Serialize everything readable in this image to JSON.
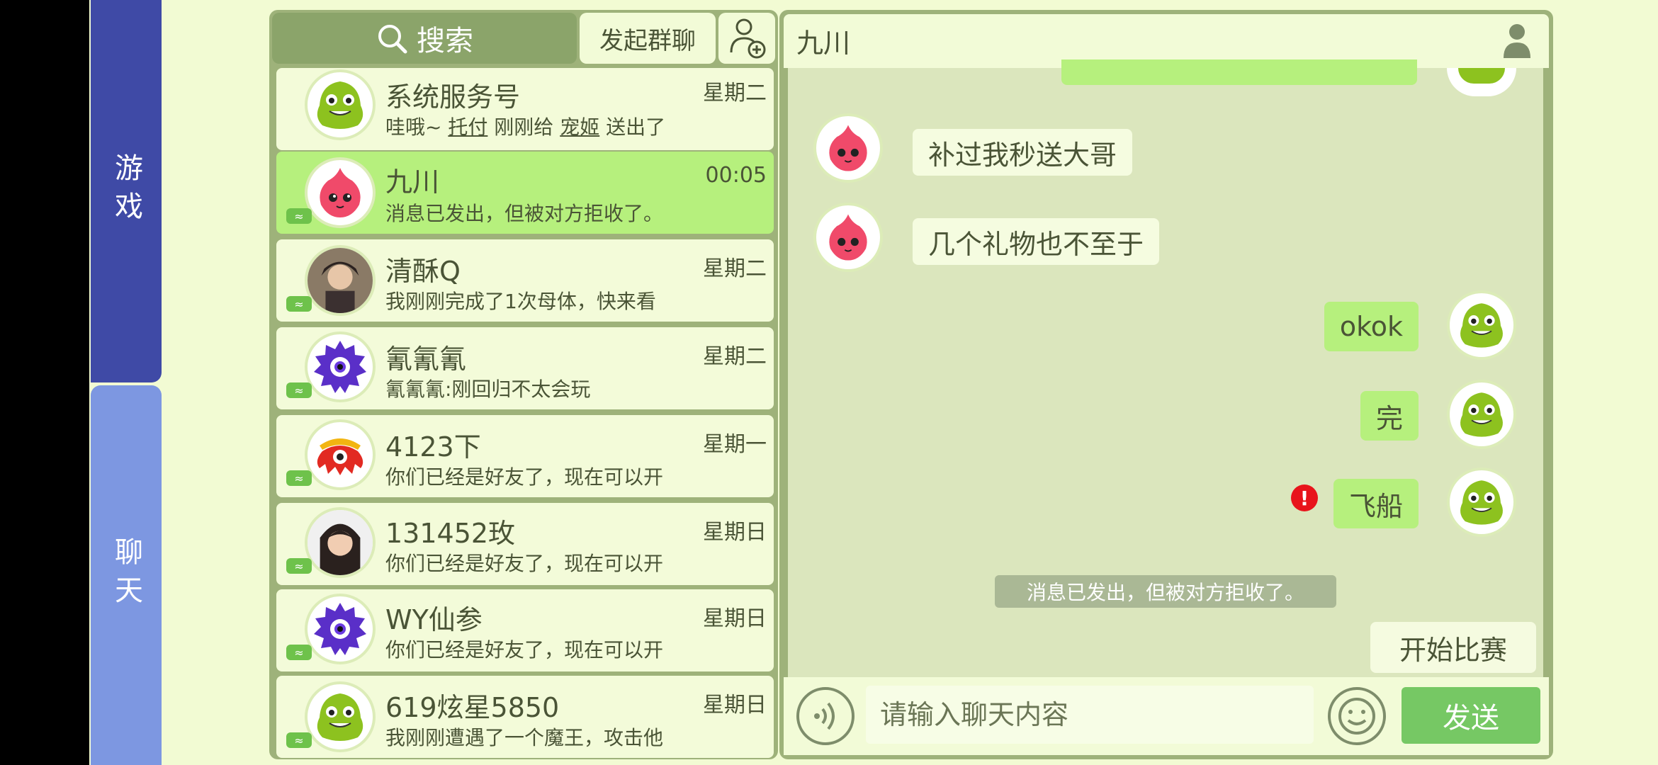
{
  "sidebar": {
    "tabs": [
      {
        "label": "游戏",
        "active": false
      },
      {
        "label": "聊天",
        "active": true
      }
    ]
  },
  "chat_list": {
    "search_label": "搜索",
    "group_chat_label": "发起群聊",
    "items": [
      {
        "name": "系统服务号",
        "time": "星期二",
        "preview_parts": [
          "哇哦~ ",
          "托付",
          " 刚刚给 ",
          "宠姬",
          " 送出了"
        ],
        "avatar": "green-monster-avatar",
        "active": false
      },
      {
        "name": "九川",
        "time": "00:05",
        "preview": "消息已发出，但被对方拒收了。",
        "avatar": "pink-blob-avatar",
        "active": true
      },
      {
        "name": "清酥Q",
        "time": "星期二",
        "preview": "我刚刚完成了1次母体，快来看",
        "avatar": "photo-avatar",
        "active": false
      },
      {
        "name": "氰氰氰",
        "time": "星期二",
        "preview": "氰氰氰:刚回归不太会玩",
        "avatar": "purple-spiky-avatar",
        "active": false
      },
      {
        "name": "4123下",
        "time": "星期一",
        "preview": "你们已经是好友了，现在可以开",
        "avatar": "red-octopus-avatar",
        "active": false
      },
      {
        "name": "131452玫",
        "time": "星期日",
        "preview": "你们已经是好友了，现在可以开",
        "avatar": "photo-avatar",
        "active": false
      },
      {
        "name": "WY仙参",
        "time": "星期日",
        "preview": "你们已经是好友了，现在可以开",
        "avatar": "purple-spiky-avatar",
        "active": false
      },
      {
        "name": "619炫星5850",
        "time": "星期日",
        "preview": "我刚刚遭遇了一个魔王，攻击他",
        "avatar": "green-monster-avatar",
        "active": false
      }
    ]
  },
  "conversation": {
    "title": "九川",
    "messages": [
      {
        "side": "left",
        "text": "补过我秒送大哥"
      },
      {
        "side": "left",
        "text": "几个礼物也不至于"
      },
      {
        "side": "right",
        "text": "okok"
      },
      {
        "side": "right",
        "text": "完"
      },
      {
        "side": "right",
        "text": "飞船",
        "error": true
      }
    ],
    "error_mark": "!",
    "system_note": "消息已发出，但被对方拒收了。",
    "start_match_label": "开始比赛",
    "input_placeholder": "请输入聊天内容",
    "send_label": "发送"
  },
  "colors": {
    "active_item": "#b6f07d",
    "send_button": "#76c864",
    "tab_game": "#3f4aa6",
    "tab_chat": "#7d97e1",
    "error": "#e8141b"
  }
}
